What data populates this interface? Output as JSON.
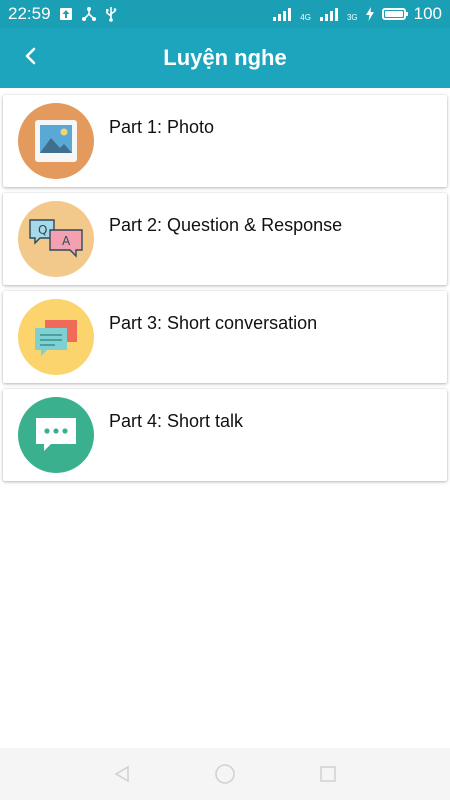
{
  "status_bar": {
    "time": "22:59",
    "network_labels": [
      "4G",
      "3G"
    ],
    "battery": "100",
    "icons": [
      "upload-icon",
      "share-hub-icon",
      "usb-icon",
      "signal-icon",
      "signal-icon",
      "charging-icon",
      "battery-icon"
    ]
  },
  "app_bar": {
    "title": "Luyện nghe",
    "back_icon": "chevron-left-icon",
    "color": "#1da5bd"
  },
  "parts": [
    {
      "label": "Part 1: Photo",
      "icon": "photo-icon",
      "color": "#e39a5c"
    },
    {
      "label": "Part 2: Question & Response",
      "icon": "qa-chat-icon",
      "color": "#f3c98b"
    },
    {
      "label": "Part 3: Short conversation",
      "icon": "conversation-icon",
      "color": "#fbd46d"
    },
    {
      "label": "Part 4: Short talk",
      "icon": "speech-bubble-icon",
      "color": "#3bb08f"
    }
  ],
  "nav_bar": {
    "icons": [
      "back-triangle-icon",
      "home-circle-icon",
      "recents-square-icon"
    ]
  }
}
